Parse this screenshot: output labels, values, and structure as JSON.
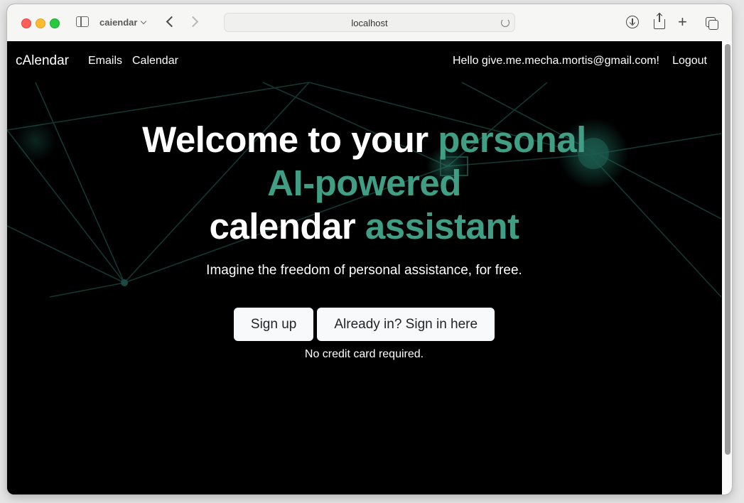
{
  "browser": {
    "tab_group_name": "caiendar",
    "address": "localhost",
    "icons": [
      "sidebar-icon",
      "back-icon",
      "forward-icon",
      "reload-icon",
      "download-icon",
      "share-icon",
      "new-tab-icon",
      "tab-overview-icon"
    ]
  },
  "navbar": {
    "brand": "cAlendar",
    "links": [
      "Emails",
      "Calendar"
    ],
    "greeting": "Hello give.me.mecha.mortis@gmail.com!",
    "logout": "Logout"
  },
  "hero": {
    "line1_white": "Welcome to your",
    "line1_accent": "personal",
    "line2_accent": "AI-powered",
    "line3_white": "calendar",
    "line3_accent": "assistant",
    "tagline": "Imagine the freedom of personal assistance, for free.",
    "signup": "Sign up",
    "signin": "Already in? Sign in here",
    "note": "No credit card required."
  },
  "colors": {
    "accent": "#3f9e84",
    "background": "#000000",
    "button_bg": "#f8f9fa"
  }
}
